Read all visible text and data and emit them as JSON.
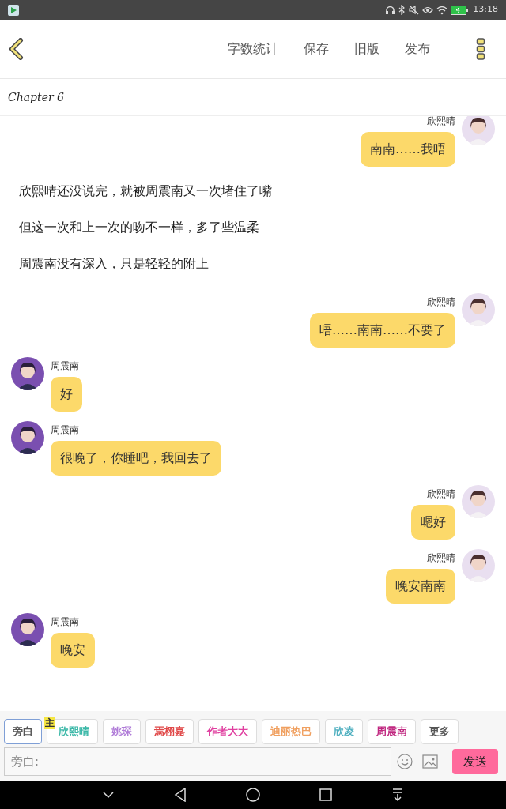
{
  "status_bar": {
    "time": "13:18"
  },
  "toolbar": {
    "actions": [
      "字数统计",
      "保存",
      "旧版",
      "发布"
    ]
  },
  "chapter": {
    "title": "Chapter 6"
  },
  "messages": [
    {
      "kind": "right",
      "sender": "欣熙晴",
      "text": "南南……我唔"
    },
    {
      "kind": "narration",
      "text": "欣熙晴还没说完，就被周震南又一次堵住了嘴"
    },
    {
      "kind": "narration",
      "text": "但这一次和上一次的吻不一样，多了些温柔"
    },
    {
      "kind": "narration",
      "text": "周震南没有深入，只是轻轻的附上"
    },
    {
      "kind": "right",
      "sender": "欣熙晴",
      "text": "唔……南南……不要了"
    },
    {
      "kind": "left",
      "sender": "周震南",
      "text": "好"
    },
    {
      "kind": "left",
      "sender": "周震南",
      "text": "很晚了，你睡吧，我回去了"
    },
    {
      "kind": "right",
      "sender": "欣熙晴",
      "text": "嗯好"
    },
    {
      "kind": "right",
      "sender": "欣熙晴",
      "text": "晚安南南"
    },
    {
      "kind": "left",
      "sender": "周震南",
      "text": "晚安"
    }
  ],
  "characters": [
    {
      "label": "旁白",
      "color": "#555555",
      "selected": true
    },
    {
      "label": "欣熙晴",
      "color": "#3bb8a8",
      "selected": false,
      "badge": "主"
    },
    {
      "label": "姚琛",
      "color": "#b07cd8",
      "selected": false
    },
    {
      "label": "焉栩嘉",
      "color": "#e04848",
      "selected": false
    },
    {
      "label": "作者大大",
      "color": "#e040a0",
      "selected": false
    },
    {
      "label": "迪丽热巴",
      "color": "#f0a060",
      "selected": false
    },
    {
      "label": "欣凌",
      "color": "#50b0c0",
      "selected": false
    },
    {
      "label": "周震南",
      "color": "#c02880",
      "selected": false
    },
    {
      "label": "更多",
      "color": "#555555",
      "selected": false
    }
  ],
  "composer": {
    "placeholder": "旁白:",
    "send": "发送"
  }
}
